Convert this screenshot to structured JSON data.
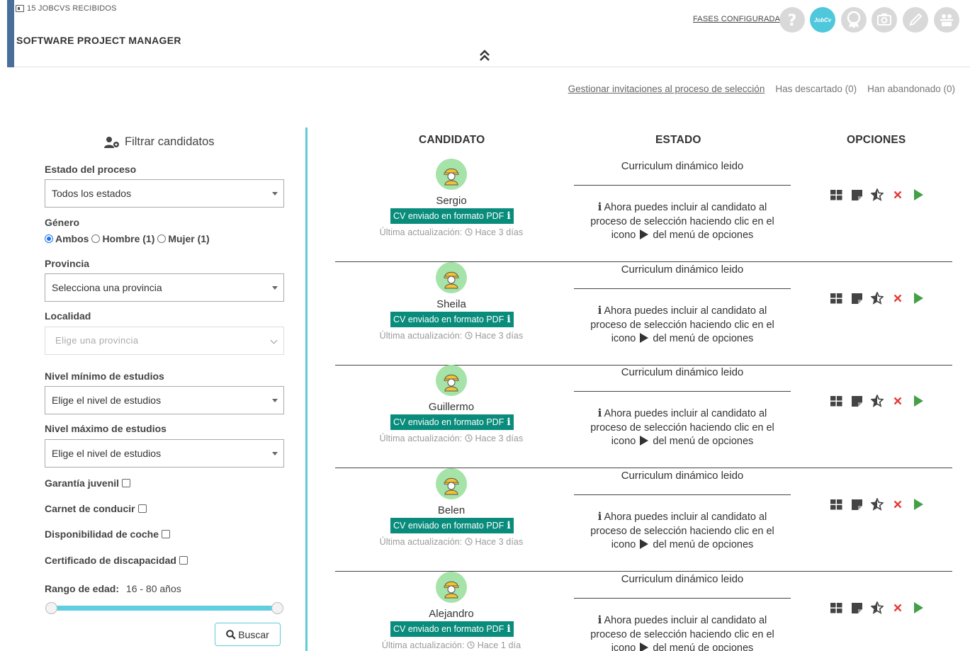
{
  "header": {
    "received_label": "15 JOBCVS RECIBIDOS",
    "job_title": "SOFTWARE PROJECT MANAGER",
    "phases_label": "FASES CONFIGURADAS:",
    "phases": [
      {
        "icon": "question-icon",
        "active": false
      },
      {
        "icon": "jobcv-logo-icon",
        "active": true,
        "text": "JobCv"
      },
      {
        "icon": "award-icon",
        "active": false
      },
      {
        "icon": "camera-icon",
        "active": false
      },
      {
        "icon": "pencil-icon",
        "active": false
      },
      {
        "icon": "interview-icon",
        "active": false
      }
    ]
  },
  "top_links": {
    "manage": "Gestionar invitaciones al proceso de selección",
    "discarded": "Has descartado (0)",
    "abandoned": "Han abandonado (0)"
  },
  "filter": {
    "title": "Filtrar candidatos",
    "process_state_label": "Estado del proceso",
    "process_state_value": "Todos los estados",
    "gender_label": "Género",
    "gender_options": [
      "Ambos",
      "Hombre (1)",
      "Mujer (1)"
    ],
    "gender_selected": "Ambos",
    "province_label": "Provincia",
    "province_value": "Selecciona una provincia",
    "locality_label": "Localidad",
    "locality_value": "Elige una provincia",
    "min_studies_label": "Nivel mínimo de estudios",
    "min_studies_value": "Elige el nivel de estudios",
    "max_studies_label": "Nivel máximo de estudios",
    "max_studies_value": "Elige el nivel de estudios",
    "youth_guarantee": "Garantía juvenil",
    "driving_license": "Carnet de conducir",
    "car_available": "Disponibilidad de coche",
    "disability_cert": "Certificado de discapacidad",
    "age_label": "Rango de edad:",
    "age_value": "16 - 80 años",
    "age_min": 16,
    "age_max": 80,
    "search_button": "Buscar"
  },
  "list": {
    "col_candidate": "CANDIDATO",
    "col_state": "ESTADO",
    "col_options": "OPCIONES",
    "badge_text": "CV enviado en formato PDF",
    "updated_prefix": "Última actualización:",
    "status_top": "Curriculum dinámico leido",
    "status_info_a": "Ahora puedes incluir al candidato al",
    "status_info_b": "proceso de selección haciendo clic en el",
    "status_info_c1": "icono",
    "status_info_c2": "del menú de opciones",
    "candidates": [
      {
        "name": "Sergio",
        "updated": "Hace 3 días"
      },
      {
        "name": "Sheila",
        "updated": "Hace 3 días"
      },
      {
        "name": "Guillermo",
        "updated": "Hace 3 días"
      },
      {
        "name": "Belen",
        "updated": "Hace 3 días"
      },
      {
        "name": "Alejandro",
        "updated": "Hace 1 día"
      }
    ]
  },
  "colors": {
    "accent": "#5fcbd6",
    "badge": "#0a8c7c",
    "header_bar": "#4a6e9a",
    "reject": "#e53935",
    "advance": "#43a047"
  }
}
